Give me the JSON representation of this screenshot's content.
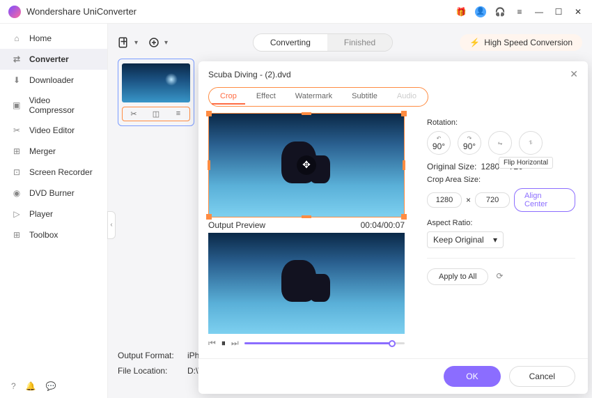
{
  "app": {
    "title": "Wondershare UniConverter"
  },
  "titlebar": {
    "gift": "gift",
    "user": "user",
    "headset": "support",
    "menu": "menu",
    "min": "minimize",
    "max": "maximize",
    "close": "close"
  },
  "sidebar": {
    "items": [
      {
        "icon": "home",
        "label": "Home"
      },
      {
        "icon": "convert",
        "label": "Converter"
      },
      {
        "icon": "download",
        "label": "Downloader"
      },
      {
        "icon": "compress",
        "label": "Video Compressor"
      },
      {
        "icon": "editor",
        "label": "Video Editor"
      },
      {
        "icon": "merge",
        "label": "Merger"
      },
      {
        "icon": "record",
        "label": "Screen Recorder"
      },
      {
        "icon": "dvd",
        "label": "DVD Burner"
      },
      {
        "icon": "play",
        "label": "Player"
      },
      {
        "icon": "toolbox",
        "label": "Toolbox"
      }
    ]
  },
  "toolbar": {
    "tab_converting": "Converting",
    "tab_finished": "Finished",
    "hsc": "High Speed Conversion"
  },
  "file": {
    "name": "Scuba Diving - (2).dvd"
  },
  "fields": {
    "output_format_label": "Output Format:",
    "output_format_value": "iPhone Xs, X",
    "file_location_label": "File Location:",
    "file_location_value": "D:\\Wonders"
  },
  "editor": {
    "title": "Scuba Diving - (2).dvd",
    "tabs": {
      "crop": "Crop",
      "effect": "Effect",
      "watermark": "Watermark",
      "subtitle": "Subtitle",
      "audio": "Audio"
    },
    "output_preview": "Output Preview",
    "time": "00:04/00:07",
    "rotation_label": "Rotation:",
    "rot_left": "90°",
    "rot_right": "90°",
    "flip_tooltip": "Flip Horizontal",
    "original_size_label": "Original Size:",
    "original_size_value": "1280 × 720",
    "crop_area_label": "Crop Area Size:",
    "crop_w": "1280",
    "crop_h": "720",
    "times": "×",
    "align_center": "Align Center",
    "aspect_label": "Aspect Ratio:",
    "aspect_value": "Keep Original",
    "apply_all": "Apply to All",
    "ok": "OK",
    "cancel": "Cancel"
  }
}
